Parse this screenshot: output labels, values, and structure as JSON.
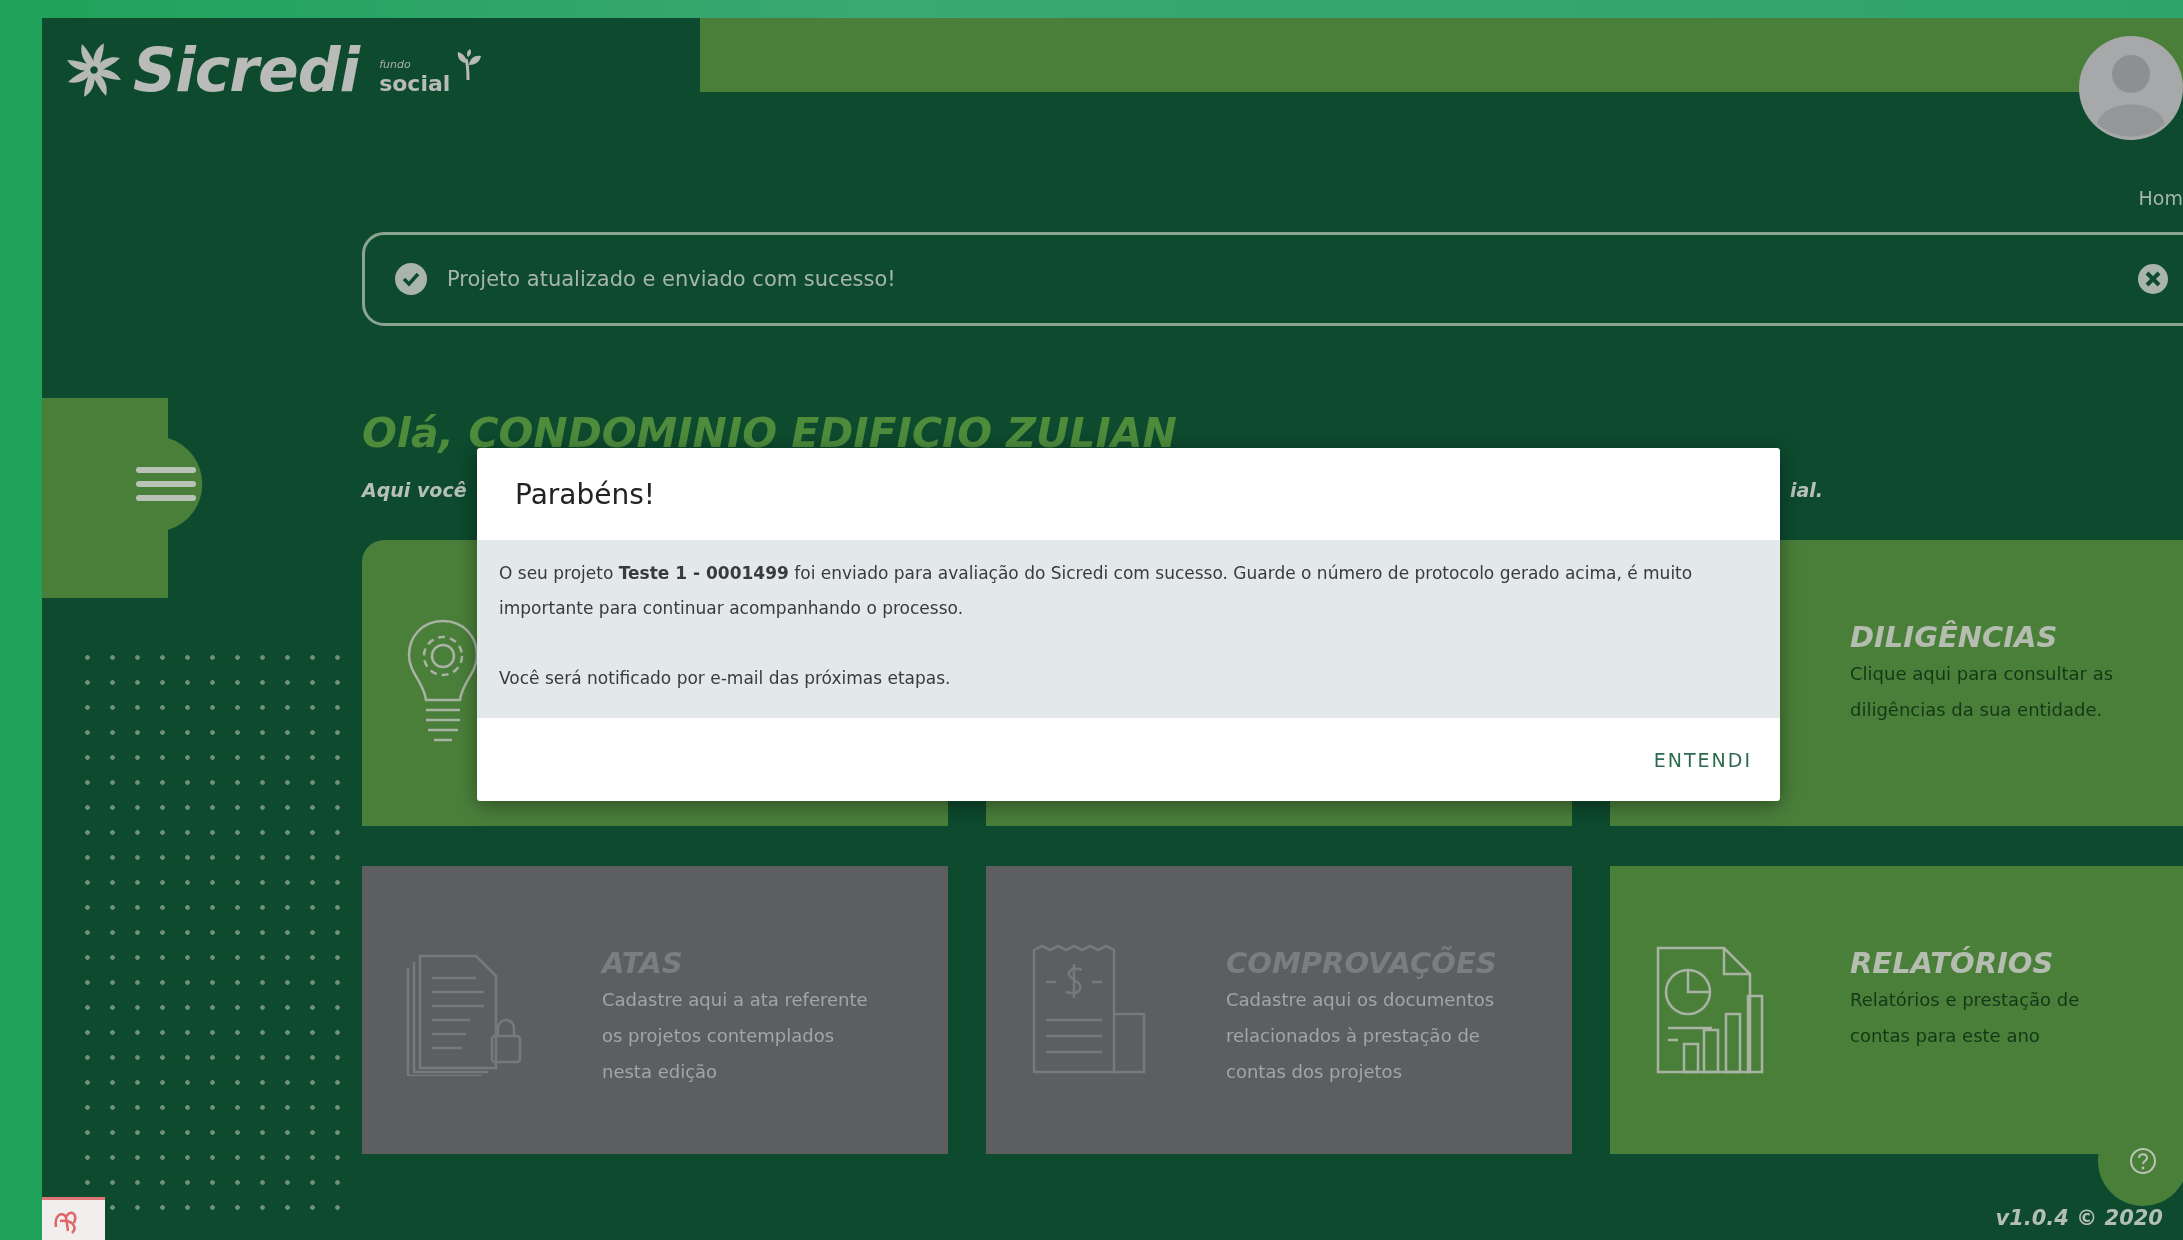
{
  "logo": {
    "brand": "Sicredi",
    "tagline_top": "fundo",
    "tagline": "social"
  },
  "top_link": "Hom",
  "alert": {
    "message": "Projeto atualizado e enviado com sucesso!"
  },
  "greeting": {
    "title": "Olá, CONDOMINIO EDIFICIO ZULIAN",
    "subtitle_start": "Aqui você",
    "subtitle_end": "ial."
  },
  "cards": [
    {
      "disabled": false
    },
    {
      "disabled": false
    },
    {
      "title": "DILIGÊNCIAS",
      "description": "Clique aqui para consultar as diligências da sua entidade.",
      "disabled": false
    },
    {
      "title": "ATAS",
      "description": "Cadastre aqui a ata referente os projetos contemplados nesta edição",
      "disabled": true
    },
    {
      "title": "COMPROVAÇÕES",
      "description": "Cadastre aqui os documentos relacionados à prestação de contas dos projetos",
      "disabled": true
    },
    {
      "title": "RELATÓRIOS",
      "description": "Relatórios e prestação de contas para este ano",
      "disabled": false
    }
  ],
  "modal": {
    "title": "Parabéns!",
    "paragraphs": [
      "O seu projeto **Teste 1 - 0001499** foi enviado para avaliação do Sicredi com sucesso. Guarde o número de protocolo gerado acima, é muito importante para continuar acompanhando o processo.",
      "Você será notificado por e-mail das próximas etapas."
    ],
    "button": "ENTENDI"
  },
  "version": "v1.0.4 © 2020"
}
